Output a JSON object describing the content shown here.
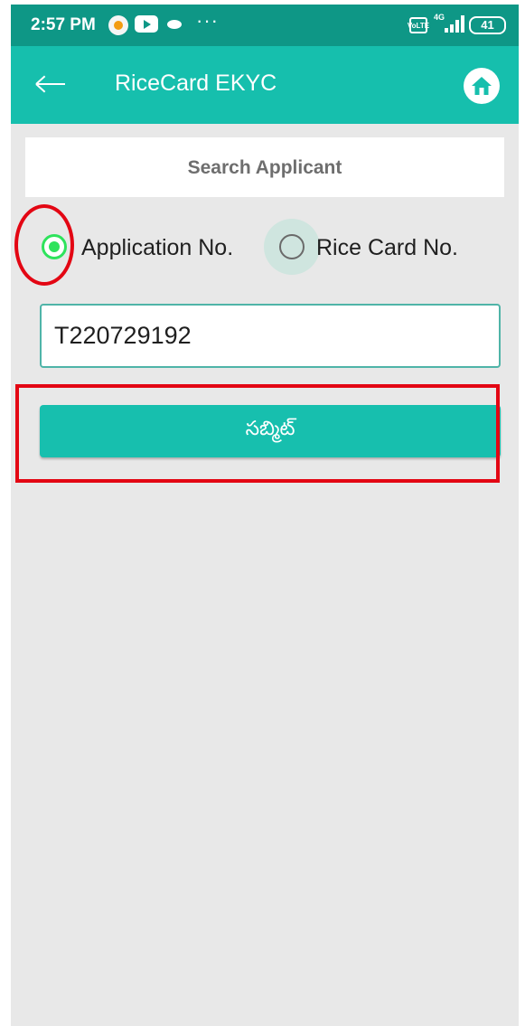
{
  "status_bar": {
    "time": "2:57 PM",
    "dots": "···",
    "volte": "VoLTE",
    "network": "4G",
    "battery": "41",
    "icons": [
      "app-notification-icon",
      "youtube-icon",
      "eye-icon",
      "more-dots-icon",
      "volte-icon",
      "signal-icon",
      "battery-icon"
    ]
  },
  "app_bar": {
    "title": "RiceCard EKYC",
    "back_icon": "arrow-left-icon",
    "home_icon": "home-icon",
    "color": "#16bfad"
  },
  "search": {
    "title": "Search Applicant",
    "options": [
      {
        "label": "Application No.",
        "selected": true
      },
      {
        "label": "Rice Card No.",
        "selected": false
      }
    ],
    "input_value": "T220729192",
    "submit_label": "సబ్మిట్"
  },
  "colors": {
    "accent": "#16bfad",
    "status_bar": "#0e9786",
    "radio_selected": "#2ee35c",
    "highlight": "#e30613",
    "background": "#e8e8e8"
  }
}
